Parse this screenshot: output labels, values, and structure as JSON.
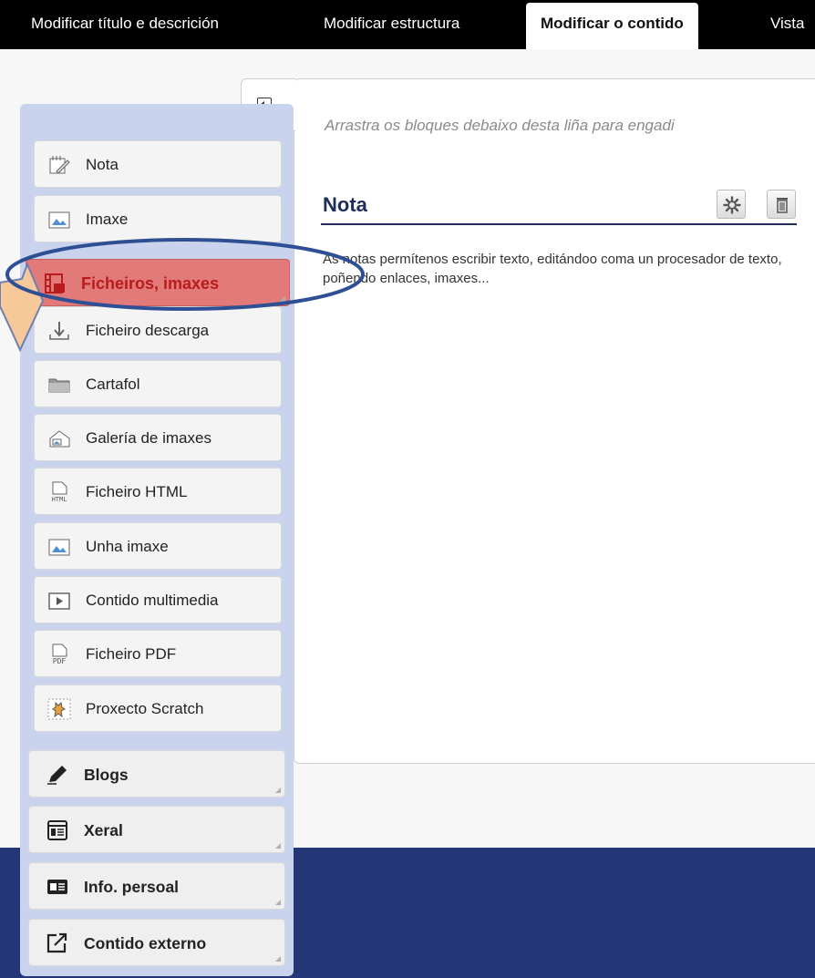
{
  "tabs": [
    {
      "label": "Modificar título e descrición"
    },
    {
      "label": "Modificar estructura"
    },
    {
      "label": "Modificar o contido"
    },
    {
      "label": "Vista"
    }
  ],
  "main": {
    "hint": "Arrastra os bloques debaixo desta liña para engadi",
    "block": {
      "title": "Nota",
      "description": "As notas permítenos escribir texto, editándoo coma un procesador de texto, poñendo enlaces, imaxes..."
    }
  },
  "sidebar": {
    "items": [
      {
        "label": "Nota",
        "icon": "note-icon"
      },
      {
        "label": "Imaxe",
        "icon": "image-icon"
      },
      {
        "label": "Ficheiros, imaxes",
        "icon": "film-icon"
      },
      {
        "label": "Ficheiro descarga",
        "icon": "download-icon"
      },
      {
        "label": "Cartafol",
        "icon": "folder-icon"
      },
      {
        "label": "Galería de imaxes",
        "icon": "gallery-icon"
      },
      {
        "label": "Ficheiro HTML",
        "icon": "html-file-icon"
      },
      {
        "label": "Unha imaxe",
        "icon": "image-icon"
      },
      {
        "label": "Contido multimedia",
        "icon": "multimedia-icon"
      },
      {
        "label": "Ficheiro PDF",
        "icon": "pdf-file-icon"
      },
      {
        "label": "Proxecto Scratch",
        "icon": "scratch-icon"
      },
      {
        "label": "Blogs",
        "icon": "pencil-icon"
      },
      {
        "label": "Xeral",
        "icon": "general-icon"
      },
      {
        "label": "Info. persoal",
        "icon": "id-card-icon"
      },
      {
        "label": "Contido externo",
        "icon": "external-icon"
      }
    ]
  },
  "colors": {
    "accent": "#1f2d5a",
    "highlight": "#e27a7a",
    "highlight_text": "#b81c1c",
    "annotation_ring": "#2f4f94",
    "arrow": "#f6c89a",
    "sidebar_bg": "#c9d3ee",
    "footer": "#233676"
  }
}
